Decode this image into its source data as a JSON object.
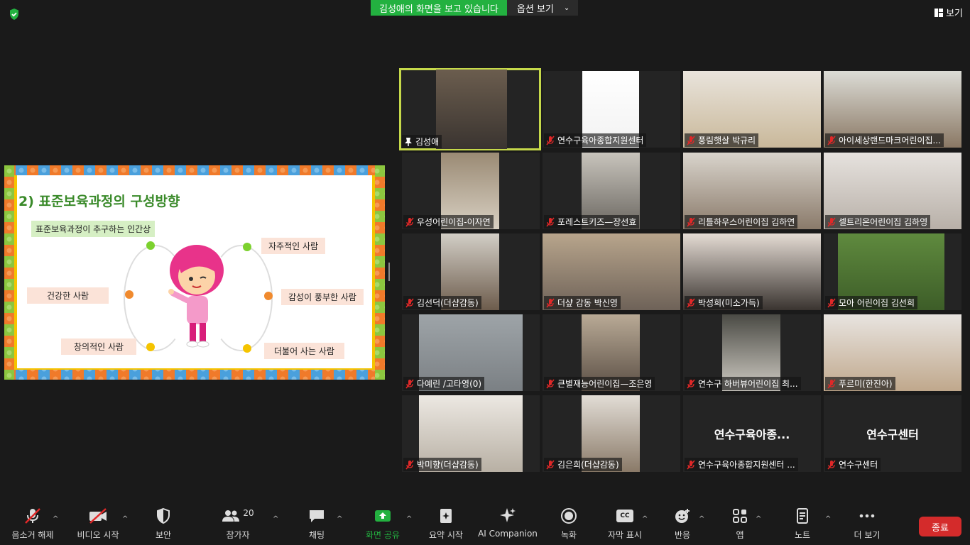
{
  "share_banner": {
    "label": "김성애의 화면을 보고 있습니다",
    "options": "옵션 보기"
  },
  "view_label": "보기",
  "slide": {
    "title": "2) 표준보육과정의 구성방향",
    "subtitle": "표준보육과정이 추구하는 인간상",
    "traits": [
      "자주적인 사람",
      "건강한 사람",
      "감성이 풍부한 사람",
      "창의적인 사람",
      "더불어 사는 사람"
    ]
  },
  "participants": [
    {
      "name": "김성애",
      "muted": false,
      "active": true
    },
    {
      "name": "연수구육아종합지원센터",
      "muted": true
    },
    {
      "name": "풍림햇살 박규리",
      "muted": true
    },
    {
      "name": "아이세상랜드마크어린이집...",
      "muted": true
    },
    {
      "name": "우성어린이집-이자연",
      "muted": true
    },
    {
      "name": "포레스트키즈—장선효",
      "muted": true
    },
    {
      "name": "리틀하우스어린이집 김하연",
      "muted": true
    },
    {
      "name": "셀트리온어린이집 김하영",
      "muted": true
    },
    {
      "name": "김선덕(더샵감동)",
      "muted": true
    },
    {
      "name": "더샾 감동 박신영",
      "muted": true
    },
    {
      "name": "박성희(미소가득)",
      "muted": true
    },
    {
      "name": "모아 어린이집 김선희",
      "muted": true
    },
    {
      "name": "다예린 /고타영(0)",
      "muted": true
    },
    {
      "name": "큰별재능어린이집—조은영",
      "muted": true
    },
    {
      "name": "연수구 하버뷰어린이집 최...",
      "muted": true
    },
    {
      "name": "푸르미(한진아)",
      "muted": true
    },
    {
      "name": "박미향(더샵감동)",
      "muted": true
    },
    {
      "name": "김은희(더샵감동)",
      "muted": true
    },
    {
      "name": "연수구육아종합지원센터 ...",
      "muted": true,
      "display": "연수구육아종..."
    },
    {
      "name": "연수구센터",
      "muted": true,
      "display": "연수구센터"
    }
  ],
  "toolbar": {
    "unmute": "음소거 해제",
    "start_video": "비디오 시작",
    "security": "보안",
    "participants": "참가자",
    "participants_count": "20",
    "chat": "채팅",
    "share_screen": "화면 공유",
    "summary": "요약 시작",
    "ai_companion": "AI Companion",
    "record": "녹화",
    "captions": "자막 표시",
    "captions_icon_text": "CC",
    "reactions": "반응",
    "apps": "앱",
    "notes": "노트",
    "more": "더 보기",
    "end": "종료"
  },
  "colors": {
    "share_green": "#23b140",
    "end_red": "#d42b2b",
    "active_speaker": "#c6d94a",
    "mute_red": "#e02828"
  }
}
